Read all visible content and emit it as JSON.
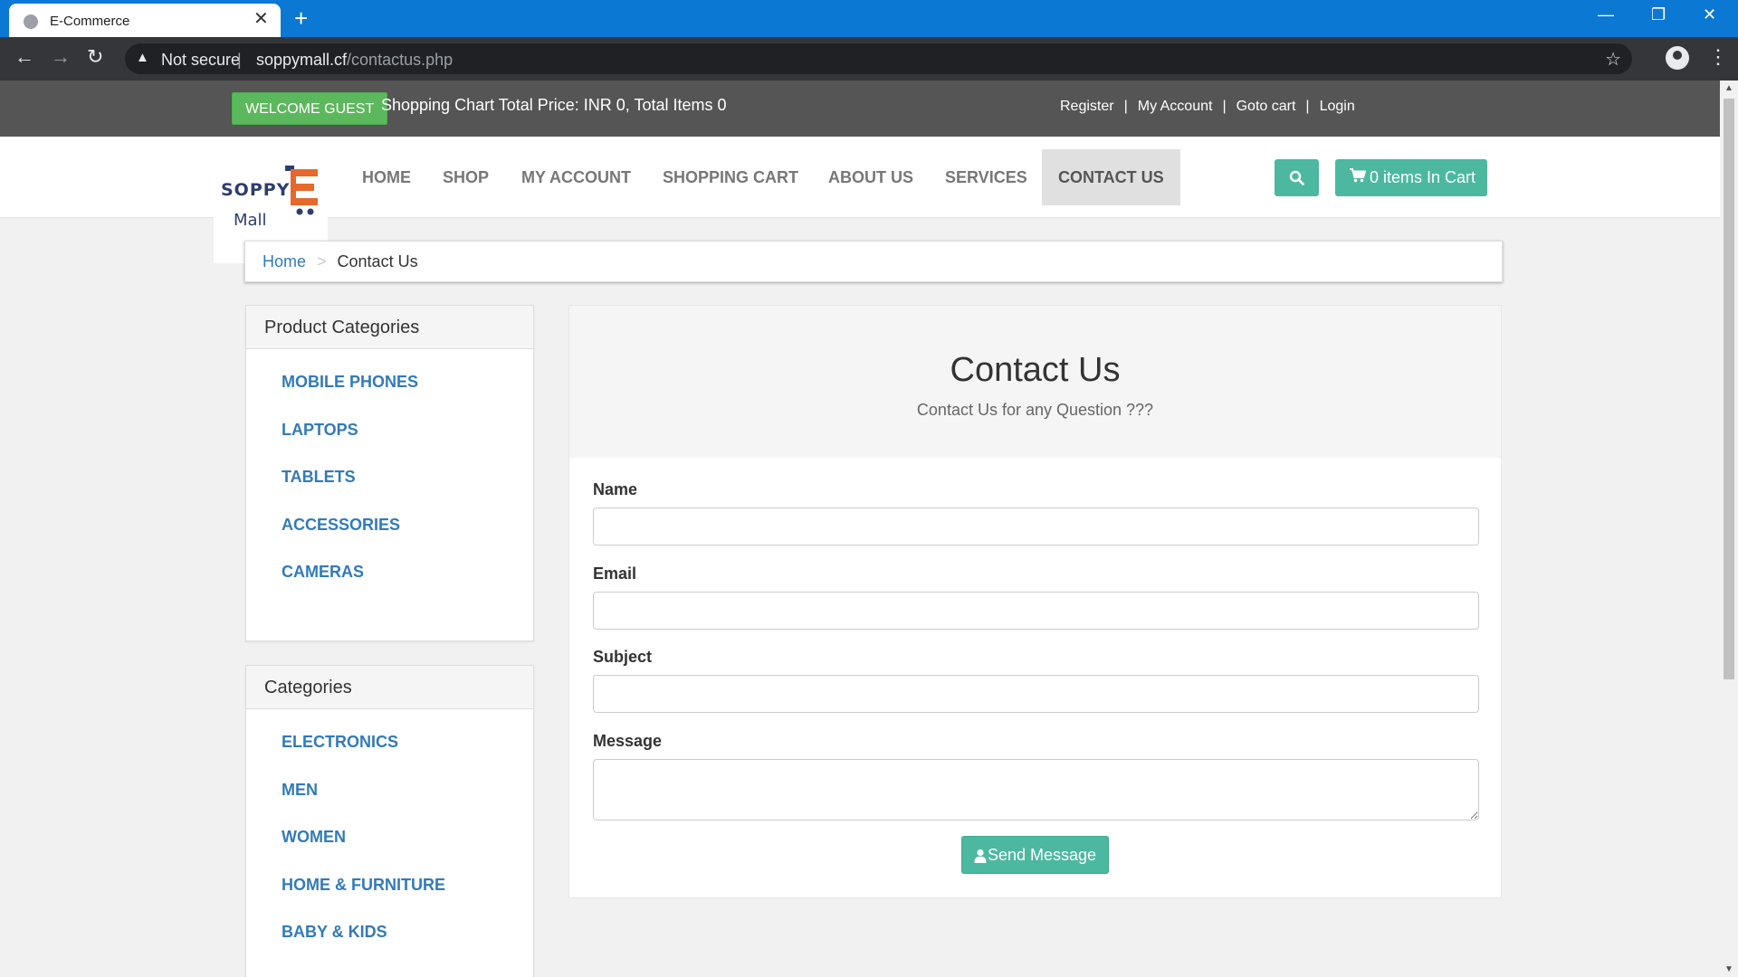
{
  "browser": {
    "tab_title": "E-Commerce",
    "security_label": "Not secure",
    "url_host": "soppymall.cf",
    "url_path": "/contactus.php"
  },
  "topbar": {
    "welcome": "WELCOME GUEST",
    "cart_summary": "Shopping Chart Total Price: INR 0, Total Items 0",
    "links": [
      "Register",
      "My Account",
      "Goto cart",
      "Login"
    ]
  },
  "logo": {
    "line1": "SOPPY",
    "line2": "Mall",
    "letter": "E"
  },
  "nav": {
    "items": [
      "HOME",
      "SHOP",
      "MY ACCOUNT",
      "SHOPPING CART",
      "ABOUT US",
      "SERVICES",
      "CONTACT US"
    ],
    "active": "CONTACT US",
    "cart_button": "0 items In Cart"
  },
  "breadcrumb": {
    "home": "Home",
    "separator": ">",
    "current": "Contact Us"
  },
  "sidebar": {
    "product_categories": {
      "title": "Product Categories",
      "items": [
        "MOBILE PHONES",
        "LAPTOPS",
        "TABLETS",
        "ACCESSORIES",
        "CAMERAS"
      ]
    },
    "categories": {
      "title": "Categories",
      "items": [
        "ELECTRONICS",
        "MEN",
        "WOMEN",
        "HOME & FURNITURE",
        "BABY & KIDS"
      ]
    }
  },
  "contact": {
    "title": "Contact Us",
    "subtitle": "Contact Us for any Question ???",
    "fields": {
      "name_label": "Name",
      "name_value": "",
      "email_label": "Email",
      "email_value": "",
      "subject_label": "Subject",
      "subject_value": "",
      "message_label": "Message",
      "message_value": ""
    },
    "send_button": "Send Message"
  },
  "icons": {
    "favicon": "globe-icon",
    "search": "search-icon",
    "cart": "shopping-cart-icon",
    "send": "user-icon"
  },
  "colors": {
    "browser_titlebar": "#0b78d4",
    "topbar_bg": "#555555",
    "welcome_green": "#5cb85c",
    "accent_teal": "#4cb8a0",
    "link_blue": "#337ab7"
  }
}
